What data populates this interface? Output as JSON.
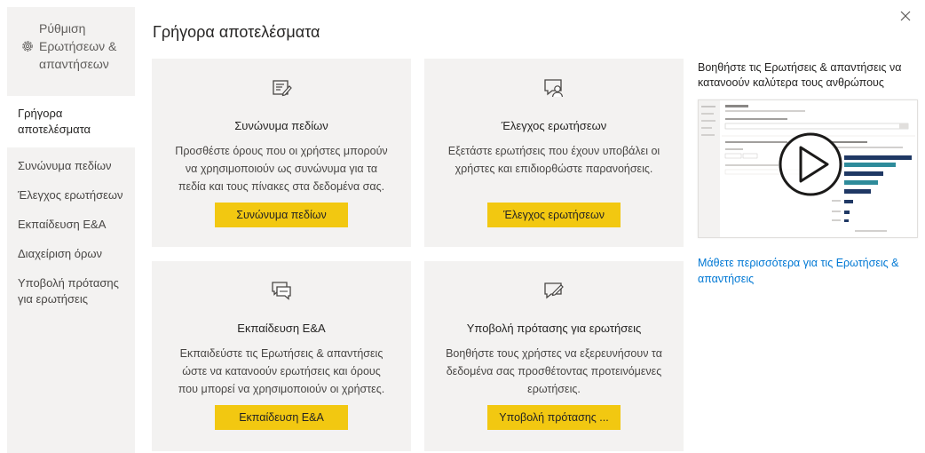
{
  "sidebar": {
    "heading_lines": [
      "Ρύθμιση",
      "Ερωτήσεων &",
      "απαντήσεων"
    ],
    "items": [
      {
        "label": "Γρήγορα αποτελέσματα",
        "active": true
      },
      {
        "label": "Συνώνυμα πεδίων",
        "active": false
      },
      {
        "label": "Έλεγχος ερωτήσεων",
        "active": false
      },
      {
        "label": "Εκπαίδευση Ε&Α",
        "active": false
      },
      {
        "label": "Διαχείριση όρων",
        "active": false
      },
      {
        "label": "Υποβολή πρότασης για ερωτήσεις",
        "active": false
      }
    ]
  },
  "main": {
    "title": "Γρήγορα αποτελέσματα",
    "cards": [
      {
        "icon": "synonyms-icon",
        "title": "Συνώνυμα πεδίων",
        "description": "Προσθέστε όρους που οι χρήστες μπορούν να χρησιμοποιούν ως συνώνυμα για τα πεδία και τους πίνακες στα δεδομένα σας.",
        "button": "Συνώνυμα πεδίων"
      },
      {
        "icon": "review-questions-icon",
        "title": "Έλεγχος ερωτήσεων",
        "description": "Εξετάστε ερωτήσεις που έχουν υποβάλει οι χρήστες και επιδιορθώστε παρανοήσεις.",
        "button": "Έλεγχος ερωτήσεων"
      },
      {
        "icon": "teach-qa-icon",
        "title": "Εκπαίδευση Ε&Α",
        "description": "Εκπαιδεύστε τις Ερωτήσεις & απαντήσεις ώστε να κατανοούν ερωτήσεις και όρους που μπορεί να χρησιμοποιούν οι χρήστες.",
        "button": "Εκπαίδευση Ε&Α"
      },
      {
        "icon": "suggest-questions-icon",
        "title": "Υποβολή πρότασης για ερωτήσεις",
        "description": "Βοηθήστε τους χρήστες να εξερευνήσουν τα δεδομένα σας προσθέτοντας προτεινόμενες ερωτήσεις.",
        "button": "Υποβολή πρότασης ..."
      }
    ]
  },
  "help": {
    "title": "Βοηθήστε τις Ερωτήσεις & απαντήσεις να κατανοούν καλύτερα τους ανθρώπους",
    "video_icon": "play-icon",
    "link": "Μάθετε περισσότερα για τις Ερωτήσεις & απαντήσεις"
  },
  "icons": {
    "settings": "gear-icon",
    "close": "close-icon"
  },
  "colors": {
    "accent_button": "#f2c811",
    "link": "#0078d4",
    "panel_bg": "#f3f2f1",
    "chart_bar": "#1f3864",
    "chart_bar_alt": "#2e8b9a"
  }
}
